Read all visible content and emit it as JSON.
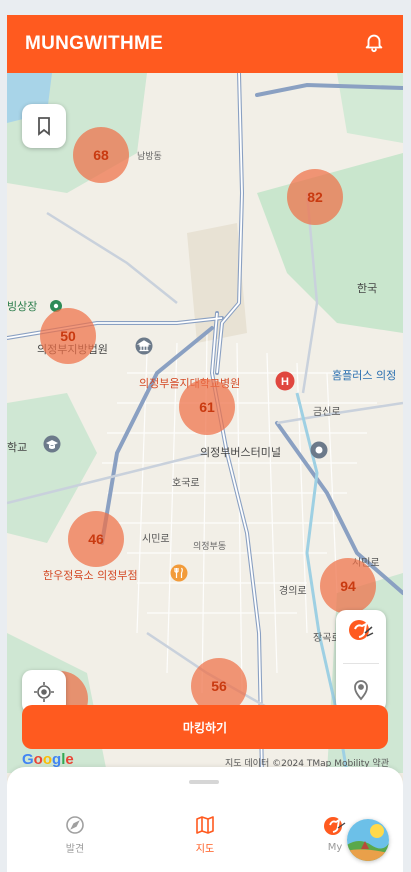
{
  "app": {
    "title": "MUNGWITHME"
  },
  "header": {
    "bell_icon": "bell-icon"
  },
  "map": {
    "labels": {
      "court": "의정부지방법원",
      "hospital": "의정부을지대학교병원",
      "terminal": "의정부버스터미널",
      "restaurant": "한우정육소 의정부점",
      "homeplus": "홈플러스 의정",
      "uijeongbu_city": "의정부동",
      "uijeongbu_city2": "한국",
      "market": "빙상장",
      "school": "학교",
      "station_area": "남방동",
      "road1": "시민로",
      "road2": "시민로",
      "road3": "호국로",
      "road4": "경의로",
      "road5": "금신로",
      "road6": "장곡로",
      "road7": "의정부동"
    },
    "clusters": [
      {
        "id": "c68",
        "count": "68"
      },
      {
        "id": "c82",
        "count": "82"
      },
      {
        "id": "c50",
        "count": "50"
      },
      {
        "id": "c61",
        "count": "61"
      },
      {
        "id": "c46",
        "count": "46"
      },
      {
        "id": "c94",
        "count": "94"
      },
      {
        "id": "c56",
        "count": "56"
      }
    ],
    "attribution": "지도 데이터 ©2024 TMap Mobility 약관",
    "google_logo": "Google"
  },
  "buttons": {
    "marking": "마킹하기"
  },
  "nav": {
    "tabs": [
      {
        "label": "발견",
        "icon": "compass-icon",
        "active": false
      },
      {
        "label": "지도",
        "icon": "map-icon",
        "active": true
      },
      {
        "label": "My",
        "icon": "profile-icon",
        "active": false
      }
    ]
  },
  "colors": {
    "accent": "#ff5a1f",
    "cluster": "#ee7048"
  }
}
